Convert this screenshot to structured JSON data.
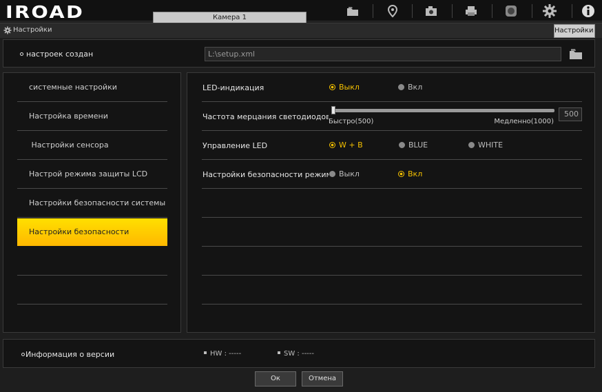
{
  "app": {
    "logo": "IROAD",
    "camera_tab": "Камера 1"
  },
  "toolbar_icons": [
    "folder-icon",
    "location-pin-icon",
    "camera-icon",
    "printer-icon",
    "record-icon",
    "gear-icon",
    "info-icon"
  ],
  "titlebar": {
    "title": "Настройки",
    "default_button": "Настройки по умолчанию"
  },
  "setup": {
    "label": "настроек создан",
    "path": "L:\\setup.xml"
  },
  "menu": {
    "items": [
      {
        "label": "системные настройки",
        "active": false
      },
      {
        "label": "Настройка времени",
        "active": false
      },
      {
        "label": " Настройки сенсора",
        "active": false
      },
      {
        "label": "Настрой режима защиты LCD",
        "active": false
      },
      {
        "label": "Настройки безопасности системы",
        "active": false
      },
      {
        "label": "Настройки безопасности",
        "active": true
      }
    ]
  },
  "settings": {
    "led_indication": {
      "label": "LED-индикация",
      "options": [
        {
          "label": "Выкл",
          "selected": true
        },
        {
          "label": "Вкл",
          "selected": false
        }
      ]
    },
    "blink_rate": {
      "label": "Частота мерцания светодиодов",
      "min_label": "Быстро(500)",
      "max_label": "Медленно(1000)",
      "min": 500,
      "max": 1000,
      "value": "500"
    },
    "led_control": {
      "label": "Управление LED",
      "options": [
        {
          "label": "W + B",
          "selected": true
        },
        {
          "label": "BLUE",
          "selected": false
        },
        {
          "label": "WHITE",
          "selected": false
        }
      ]
    },
    "security_mode": {
      "label": "Настройки безопасности режима з",
      "options": [
        {
          "label": "Выкл",
          "selected": false
        },
        {
          "label": "Вкл",
          "selected": true
        }
      ]
    }
  },
  "version": {
    "label": "Информация о версии",
    "hw": "HW : -----",
    "sw": "SW : -----"
  },
  "buttons": {
    "ok": "Ок",
    "cancel": "Отмена"
  },
  "colors": {
    "accent": "#f4c000",
    "active_menu": "#ffd000"
  }
}
